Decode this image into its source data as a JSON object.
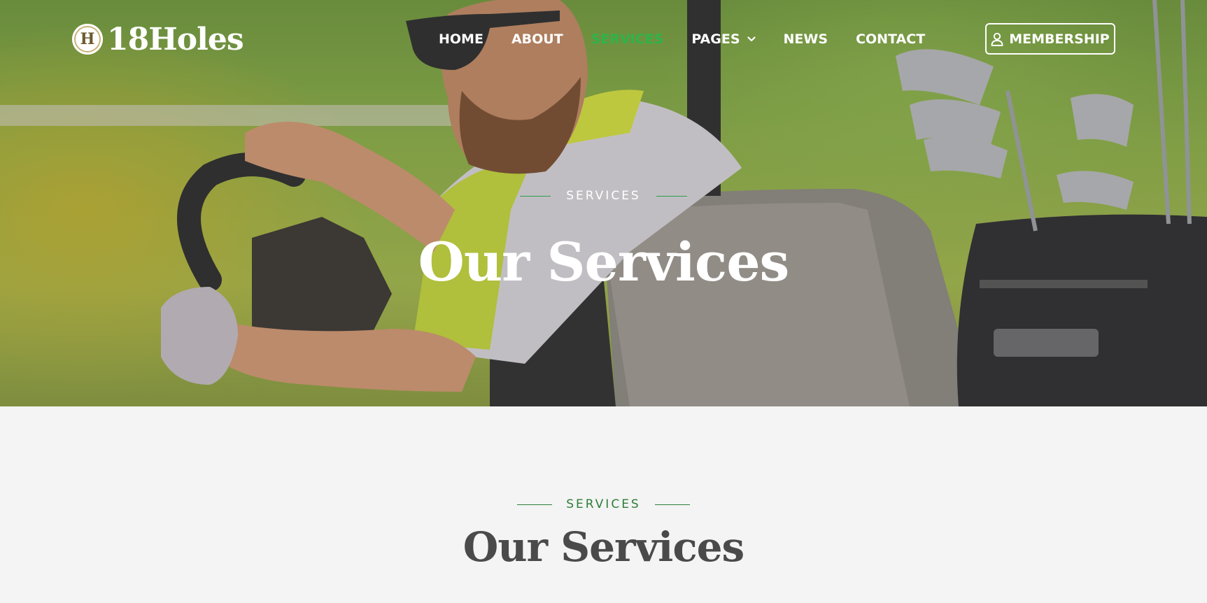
{
  "header": {
    "logo_badge": "H",
    "logo_text": "18Holes",
    "nav": [
      {
        "label": "HOME"
      },
      {
        "label": "ABOUT"
      },
      {
        "label": "SERVICES",
        "active": true
      },
      {
        "label": "PAGES",
        "has_dropdown": true
      },
      {
        "label": "NEWS"
      },
      {
        "label": "CONTACT"
      }
    ],
    "membership_label": "MEMBERSHIP",
    "membership_icon": "user-icon"
  },
  "hero": {
    "eyebrow": "SERVICES",
    "title": "Our Services",
    "background_image": "golfer-in-golf-cart"
  },
  "section": {
    "eyebrow": "SERVICES",
    "title": "Our Services"
  },
  "colors": {
    "accent": "#2fb34a",
    "eyebrow_line": "#2aa049",
    "section_eyebrow": "#2e7d3a",
    "section_title": "#4a4a4a",
    "section_bg": "#f3f4f3"
  }
}
